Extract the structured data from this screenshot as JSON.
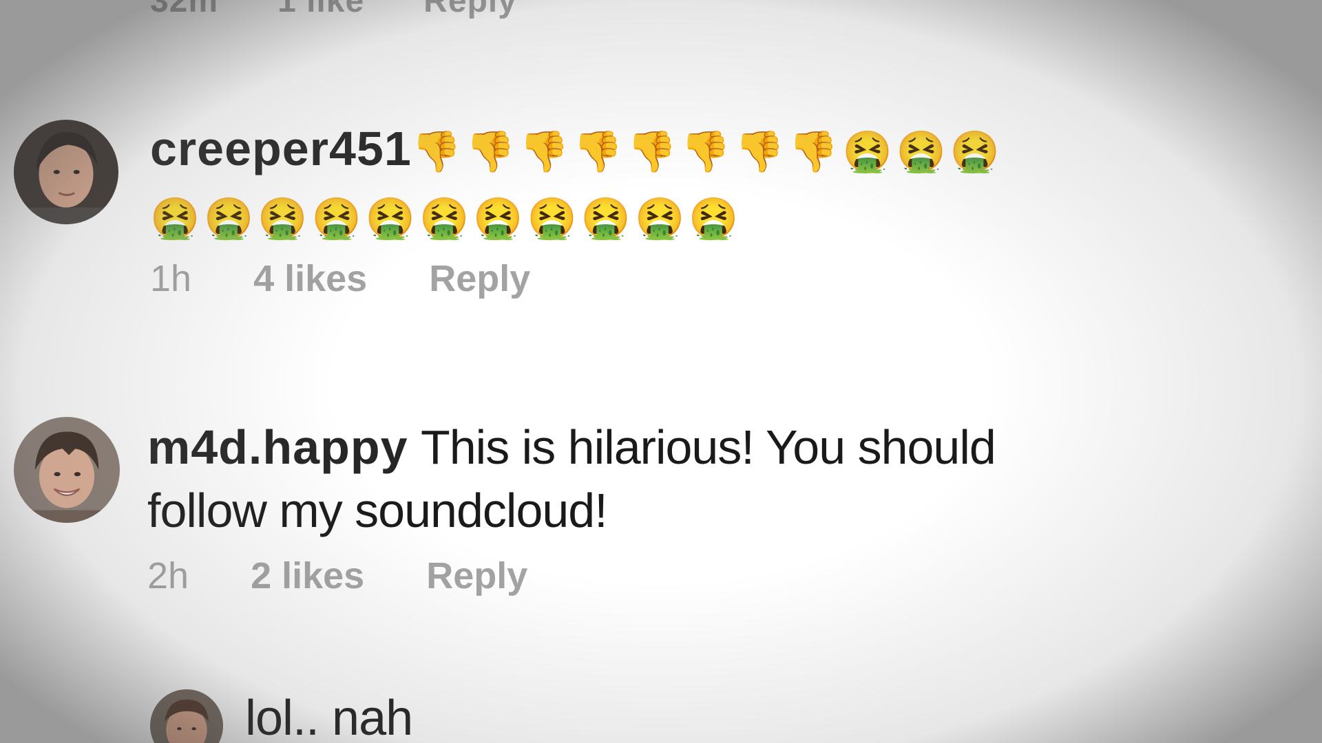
{
  "top_partial": {
    "time": "32m",
    "likes": "1 like",
    "reply": "Reply"
  },
  "comments": [
    {
      "username": "creeper451",
      "text_line1": "👎👎👎👎👎👎👎👎🤮🤮🤮",
      "text_line2": "🤮🤮🤮🤮🤮🤮🤮🤮🤮🤮🤮",
      "time": "1h",
      "likes": "4 likes",
      "reply": "Reply"
    },
    {
      "username": "m4d.happy",
      "text_line1": "This is hilarious!  You should",
      "text_line2": "follow my soundcloud!",
      "time": "2h",
      "likes": "2 likes",
      "reply": "Reply"
    },
    {
      "text_line1": "lol.. nah"
    }
  ]
}
